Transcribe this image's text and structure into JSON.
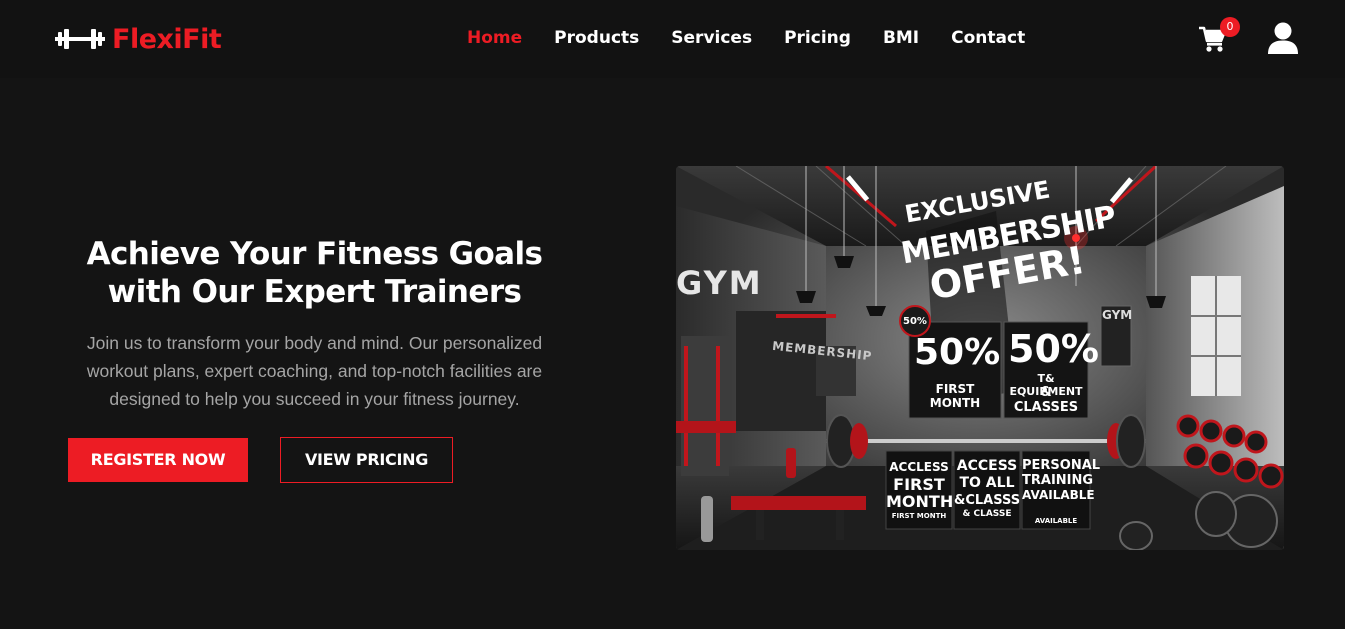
{
  "brand": {
    "name": "FlexiFit",
    "icon": "dumbbell-icon",
    "accent_color": "#ed1c24"
  },
  "nav": {
    "items": [
      {
        "label": "Home",
        "active": true
      },
      {
        "label": "Products",
        "active": false
      },
      {
        "label": "Services",
        "active": false
      },
      {
        "label": "Pricing",
        "active": false
      },
      {
        "label": "BMI",
        "active": false
      },
      {
        "label": "Contact",
        "active": false
      }
    ]
  },
  "header_actions": {
    "cart_icon": "cart-icon",
    "cart_count": "0",
    "user_icon": "user-icon"
  },
  "hero": {
    "title_line1": "Achieve Your Fitness Goals",
    "title_line2": "with Our Expert Trainers",
    "description": "Join us to transform your body and mind. Our personalized workout plans, expert coaching, and top-notch facilities are designed to help you succeed in your fitness journey.",
    "primary_button": "REGISTER NOW",
    "secondary_button": "VIEW PRICING"
  },
  "promo_image": {
    "gym_sign": "GYM",
    "gym_sign_small": "GYM",
    "wall_text": "MEMBERSHIP",
    "headline_1": "EXCLUSIVE",
    "headline_2": "MEMBERSHIP",
    "headline_3": "OFFER!",
    "badge": "50%",
    "card1_big": "50%",
    "card1_small": "FIRST MONTH",
    "card2_big": "50%",
    "card2_small_1": "T& EQUIPMENT",
    "card2_small_2": "& CLASSES",
    "panel1_l1": "ACCLESS",
    "panel1_l2": "FIRST",
    "panel1_l3": "MONTH",
    "panel1_l4": "FIRST MONTH",
    "panel2_l1": "ACCESS",
    "panel2_l2": "TO ALL",
    "panel2_l3": "&CLASSS",
    "panel2_l4": "& CLASSE",
    "panel3_l1": "PERSONAL",
    "panel3_l2": "TRAINING",
    "panel3_l3": "AVAILABLE",
    "panel3_l4": "AVAILABLE"
  }
}
